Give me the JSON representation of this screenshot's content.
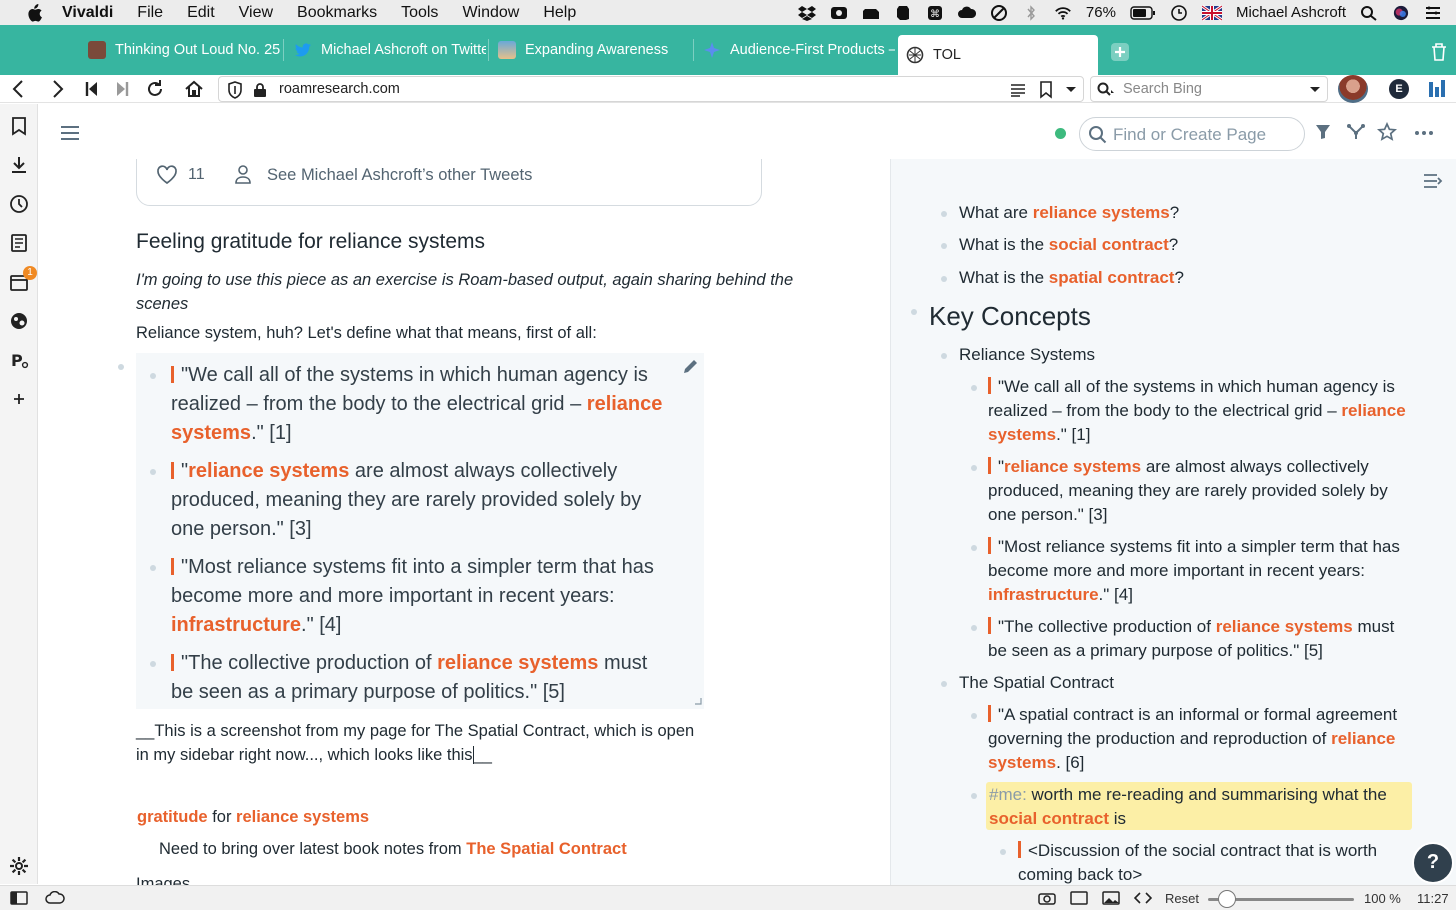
{
  "menubar": {
    "app_name": "Vivaldi",
    "items": [
      "File",
      "Edit",
      "View",
      "Bookmarks",
      "Tools",
      "Window",
      "Help"
    ],
    "battery": "76%",
    "user": "Michael Ashcroft"
  },
  "tabs": [
    {
      "label": "Thinking Out Loud No. 25",
      "color": "#7a4a3a"
    },
    {
      "label": "Michael Ashcroft on Twitter",
      "color": "#1d9bf0"
    },
    {
      "label": "Expanding Awareness",
      "color": "#6aa8d8"
    },
    {
      "label": "Audience-First Products –",
      "color": "#5b8def"
    },
    {
      "label": "TOL",
      "color": "#444"
    }
  ],
  "address": {
    "url": "roamresearch.com",
    "search_placeholder": "Search Bing"
  },
  "roam": {
    "find_placeholder": "Find or Create Page",
    "status_color": "#3dba7e"
  },
  "main": {
    "tweet_likes": "11",
    "tweet_link": "See Michael Ashcroft’s other Tweets",
    "heading": "Feeling gratitude for reliance systems",
    "intro_italic": "I'm going to use this piece as an exercise is Roam-based output, again sharing behind the scenes",
    "define_line": "Reliance system, huh? Let's define what that means, first of all:",
    "quotes": {
      "q1a": "\"We call all of the systems in which human agency is",
      "q1b": "realized – from the body to the electrical grid –",
      "q1link": "reliance systems",
      "q1c": ".\" [1]",
      "q2link": "reliance systems",
      "q2a": "are almost always collectively",
      "q2b": "produced, meaning they are rarely provided solely by",
      "q2c": "one person.\" [3]",
      "q3a": "\"Most reliance systems fit into a simpler term that has",
      "q3b": "become more and more important in recent years:",
      "q3link": "infrastructure",
      "q3c": ".\" [4]",
      "q4a": "\"The collective production of",
      "q4link": "reliance systems",
      "q4b": "must",
      "q4c": "be seen as a primary purpose of politics.\" [5]"
    },
    "caption_1": "__This is a screenshot from my page for The Spatial Contract, which is open",
    "caption_2": "in my sidebar right now..., which looks like this",
    "caption_end": "__",
    "ref_link1": "gratitude",
    "ref_for": "for",
    "ref_link2": "reliance systems",
    "note_text": "Need to bring over latest book notes from",
    "note_link": "The Spatial Contract",
    "images_label": "Images"
  },
  "sidebar": {
    "q_what_are": "What are",
    "q_link1": "reliance systems",
    "q_what_is": "What is the",
    "q_link2": "social contract",
    "q_link3": "spatial contract",
    "q_mark": "?",
    "key_concepts": "Key Concepts",
    "reliance_heading": "Reliance Systems",
    "r1a": "\"We call all of the systems in which human agency is",
    "r1b": "realized – from the body to the electrical grid –",
    "r1link": "reliance",
    "r1link2": "systems",
    "r1c": ".\" [1]",
    "r2link": "reliance systems",
    "r2a": "are almost always collectively",
    "r2b": "produced, meaning they are rarely provided solely by",
    "r2c": "one person.\" [3]",
    "r3a": "\"Most reliance systems fit into a simpler term that has",
    "r3b": "become more and more important in recent years:",
    "r3link": "infrastructure",
    "r3c": ".\" [4]",
    "r4a": "\"The collective production of",
    "r4link": "reliance systems",
    "r4b": "must",
    "r4c": "be seen as a primary purpose of politics.\" [5]",
    "spatial_heading": "The Spatial Contract",
    "s1a": "\"A spatial contract is an informal or formal agreement",
    "s1b": "governing the production and reproduction of",
    "s1link": "reliance",
    "s1link2": "systems",
    "s1c": ". [6]",
    "me_tag": "#me:",
    "me_text": "worth me re-reading and summarising what the",
    "me_link": "social contract",
    "me_is": "is",
    "disc_a": "<Discussion of the social contract that is worth",
    "disc_b": "coming back to>"
  },
  "statusbar": {
    "reset": "Reset",
    "zoom": "100 %",
    "time": "11:27",
    "zoom_level": 0.13
  },
  "notifications": {
    "calendar_badge": "1"
  }
}
